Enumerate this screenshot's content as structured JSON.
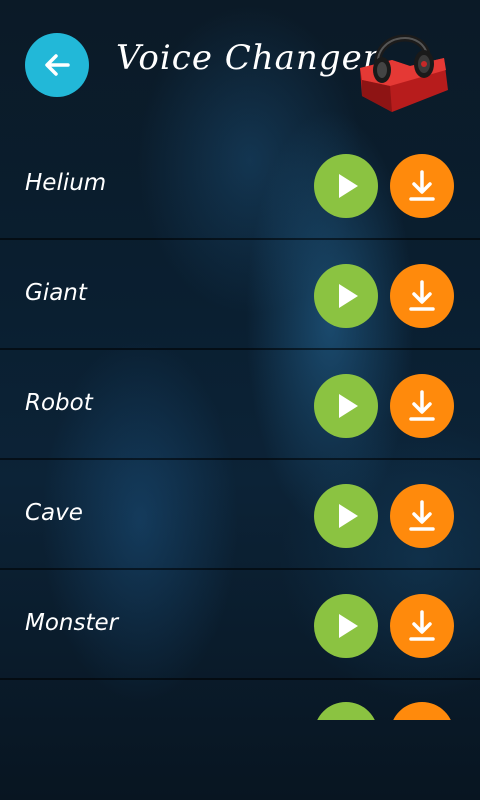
{
  "header": {
    "title": "Voice Changer",
    "back_icon": "arrow-left-icon",
    "logo_icon": "headphones-folder-icon"
  },
  "colors": {
    "back_button": "#22b8d8",
    "play_button": "#8bc341",
    "download_button": "#ff8a0c"
  },
  "effects": [
    {
      "label": "Helium"
    },
    {
      "label": "Giant"
    },
    {
      "label": "Robot"
    },
    {
      "label": "Cave"
    },
    {
      "label": "Monster"
    }
  ],
  "icons": {
    "play": "play-icon",
    "download": "download-icon"
  }
}
